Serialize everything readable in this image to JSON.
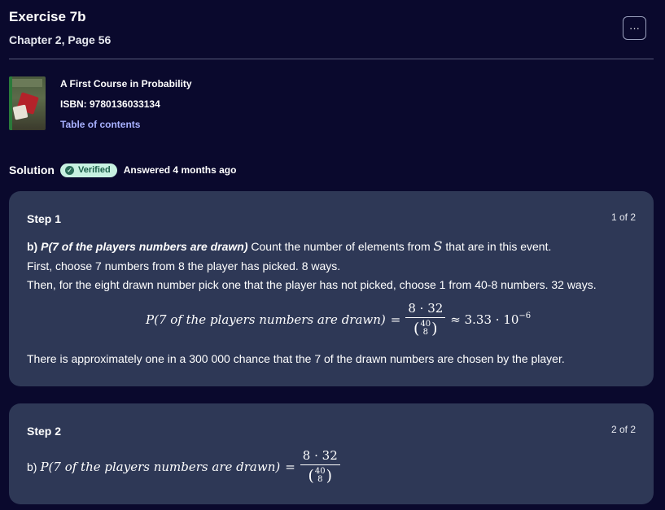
{
  "header": {
    "title": "Exercise 7b",
    "subtitle": "Chapter 2, Page 56",
    "more_label": "···"
  },
  "book": {
    "title": "A First Course in Probability",
    "isbn": "ISBN: 9780136033134",
    "toc_link": "Table of contents"
  },
  "solution": {
    "label": "Solution",
    "badge": "Verified",
    "answered": "Answered 4 months ago"
  },
  "steps": [
    {
      "label": "Step 1",
      "count": "1 of 2",
      "lead": "b)",
      "event": "P(7 of the players numbers are drawn)",
      "line1_rest": "Count the number of elements from",
      "set_symbol": "S",
      "line1_end": "that are in this event.",
      "line2": "First, choose 7 numbers from 8 the player has picked. 8 ways.",
      "line3": "Then, for the eight drawn number pick one that the player has not picked, choose 1 from 40-8 numbers. 32 ways.",
      "formula": {
        "lhs": "P(7 of the players numbers are drawn)",
        "eq": "=",
        "numerator": "8 · 32",
        "binom_top": "40",
        "binom_bottom": "8",
        "approx": "≈ 3.33 · 10",
        "exponent": "−6"
      },
      "conclusion": "There is approximately one in a 300 000 chance that the 7 of the drawn numbers are chosen by the player."
    },
    {
      "label": "Step 2",
      "count": "2 of 2",
      "prefix": "b)",
      "formula": {
        "lhs": "P(7 of the players numbers are drawn)",
        "eq": "=",
        "numerator": "8 · 32",
        "binom_top": "40",
        "binom_bottom": "8"
      }
    }
  ],
  "colors": {
    "background": "#0a092d",
    "card": "#2e3856",
    "link": "#a8b1ff",
    "badge_bg": "#c7f1e1",
    "badge_text": "#1b5e49"
  },
  "icons": {
    "more": "more-dots-icon",
    "verified": "verified-check-icon",
    "cover": "book-cover-image"
  }
}
